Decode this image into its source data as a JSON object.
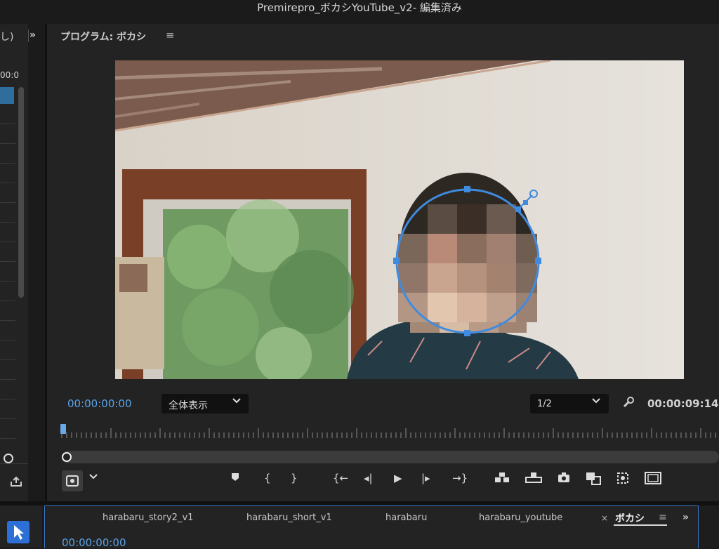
{
  "app": {
    "title": "Premirepro_ボカシYouTube_v2- 編集済み"
  },
  "left_panel": {
    "tab_fragment": "し)",
    "expand_icon": "»",
    "timecode_fragment": "00:0"
  },
  "program_monitor": {
    "title": "プログラム: ボカシ",
    "menu_icon": "≡",
    "current_timecode": "00:00:00:00",
    "zoom_label": "全体表示",
    "resolution_label": "1/2",
    "duration_timecode": "00:00:09:14",
    "playhead_position": 0.0
  },
  "transport": {
    "marker": "⬥",
    "in_point": "{",
    "out_point": "}",
    "go_to_in": "{←",
    "step_back": "◂|",
    "play": "▶",
    "step_forward": "|▸",
    "go_to_out": "→}",
    "insert": "⊟",
    "overwrite": "⊞",
    "export_frame": "📷",
    "comparison_view": "⧉",
    "multicam": "⊕",
    "safe_margins": "▭"
  },
  "timeline": {
    "tabs": [
      "harabaru_story2_v1",
      "harabaru_short_v1",
      "harabaru",
      "harabaru_youtube"
    ],
    "active_tab": "ボカシ",
    "close_icon": "×",
    "menu_icon": "≡",
    "expand_icon": "»",
    "current_timecode": "00:00:00:00"
  },
  "colors": {
    "accent_blue": "#5aa3e8",
    "mask_blue": "#3f8be0",
    "selection_tool": "#2c6fd6"
  }
}
